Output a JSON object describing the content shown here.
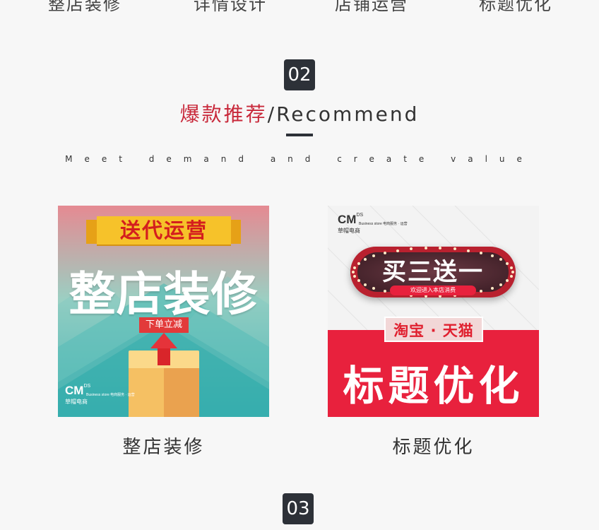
{
  "top_nav": [
    "整店装修",
    "详情设计",
    "店铺运营",
    "标题优化"
  ],
  "section02": {
    "number": "02",
    "title_zh": "爆款推荐",
    "title_sep": "/",
    "title_en": "Recommend",
    "tagline": "Meet demand and create value"
  },
  "cards": [
    {
      "ribbon": "送代运营",
      "headline": "整店装修",
      "tag": "下单立减",
      "logo_mark": "CM",
      "logo_sup": "DS",
      "logo_name": "草帽电商",
      "logo_sub": "Business store 电商服务 · 运营",
      "label": "整店装修"
    },
    {
      "logo_mark": "CM",
      "logo_sup": "DS",
      "logo_name": "草帽电商",
      "logo_sub": "Business store 电商服务 · 运营",
      "sign": "买三送一",
      "sign_sub": "欢迎进入本店消费",
      "platform": "淘宝 · 天猫",
      "headline": "标题优化",
      "label": "标题优化"
    }
  ],
  "section03": {
    "number": "03"
  }
}
